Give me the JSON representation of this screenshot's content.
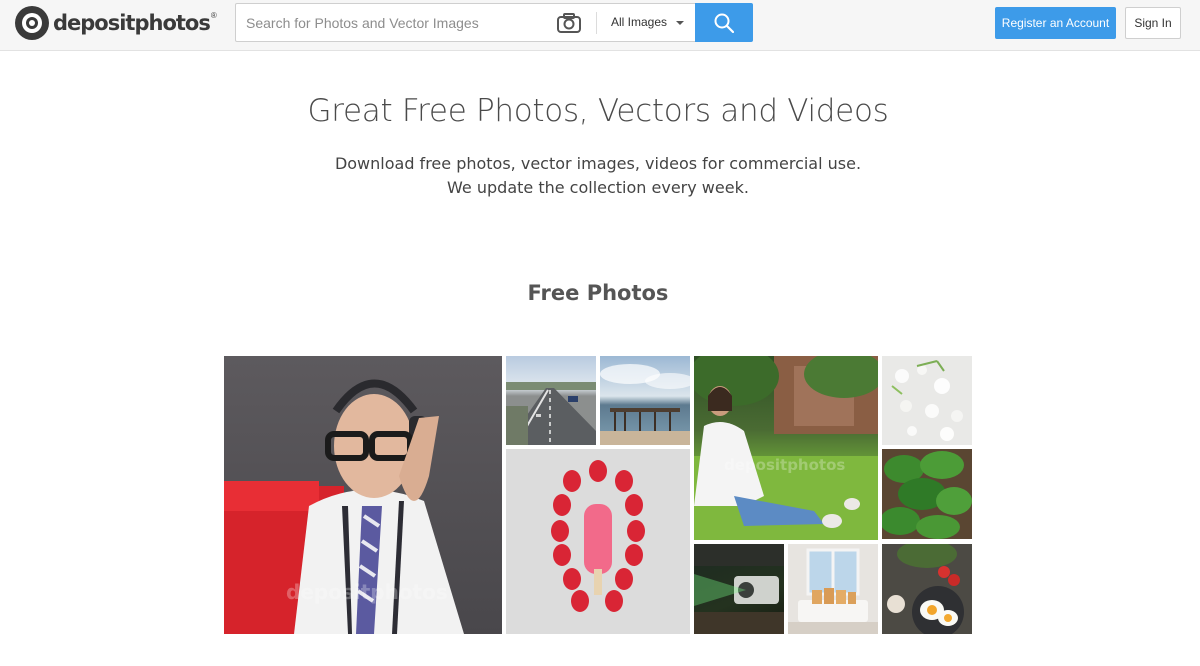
{
  "header": {
    "logo_text": "depositphotos",
    "logo_registered": "®",
    "search_placeholder": "Search for Photos and Vector Images",
    "filter_label": "All Images",
    "register_label": "Register an Account",
    "signin_label": "Sign In"
  },
  "hero": {
    "title": "Great Free Photos, Vectors and Videos",
    "subtitle_line1": "Download free photos, vector images, videos for commercial use.",
    "subtitle_line2": "We update the collection every week."
  },
  "section": {
    "title": "Free Photos"
  },
  "photos": [
    {
      "name": "man-headphones",
      "watermark": "depositphotos"
    },
    {
      "name": "highway"
    },
    {
      "name": "pier-sea"
    },
    {
      "name": "woman-grass",
      "watermark": "depositphotos"
    },
    {
      "name": "white-flowers"
    },
    {
      "name": "strawberries-popsicle"
    },
    {
      "name": "spinach-plants"
    },
    {
      "name": "projector"
    },
    {
      "name": "window-interior"
    },
    {
      "name": "breakfast-eggs"
    }
  ],
  "colors": {
    "accent": "#3d9be9",
    "header_bg": "#f6f6f6"
  }
}
